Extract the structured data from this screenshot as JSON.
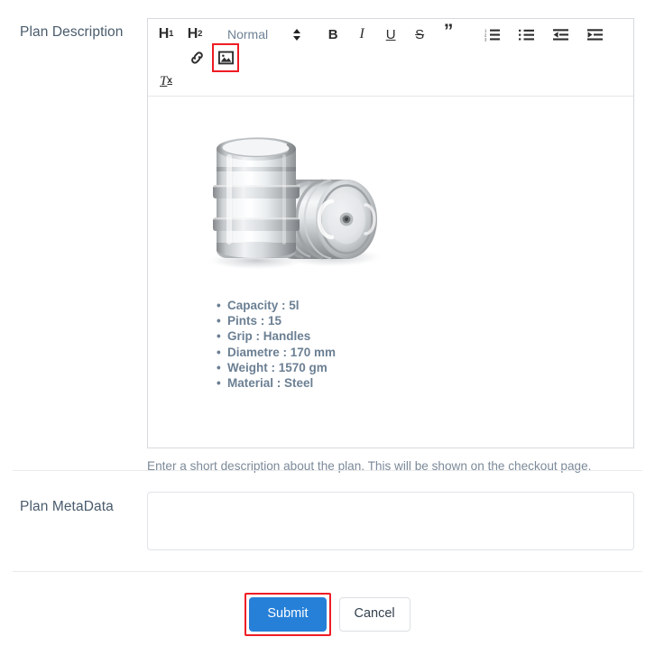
{
  "form": {
    "description_field": {
      "label": "Plan Description",
      "help_text": "Enter a short description about the plan. This will be shown on the checkout page.",
      "toolbar": {
        "h1_label": "H",
        "h1_sub": "1",
        "h2_label": "H",
        "h2_sub": "2",
        "format_picker_value": "Normal",
        "bold_label": "B",
        "italic_label": "I",
        "underline_label": "U",
        "strike_label": "S",
        "blockquote_label": "”",
        "clear_format_label": "T",
        "clear_format_sub": "x",
        "ordered_list_name": "ordered-list",
        "bullet_list_name": "bullet-list",
        "outdent_name": "outdent",
        "indent_name": "indent",
        "link_name": "link",
        "image_name": "image"
      },
      "content": {
        "image_alt": "Two stainless steel beer kegs, one upright and one lying on its side",
        "specs": [
          "Capacity : 5l",
          "Pints : 15",
          "Grip : Handles",
          "Diametre : 170 mm",
          "Weight : 1570 gm",
          "Material : Steel"
        ]
      }
    },
    "metadata_field": {
      "label": "Plan MetaData",
      "value": "",
      "placeholder": ""
    },
    "actions": {
      "submit_label": "Submit",
      "cancel_label": "Cancel"
    }
  },
  "colors": {
    "primary": "#2680d8",
    "highlight": "#ee1c24",
    "label_text": "#495b6c",
    "help_text": "#7c8a99",
    "spec_text": "#6b7f93",
    "border": "#d6dade"
  }
}
